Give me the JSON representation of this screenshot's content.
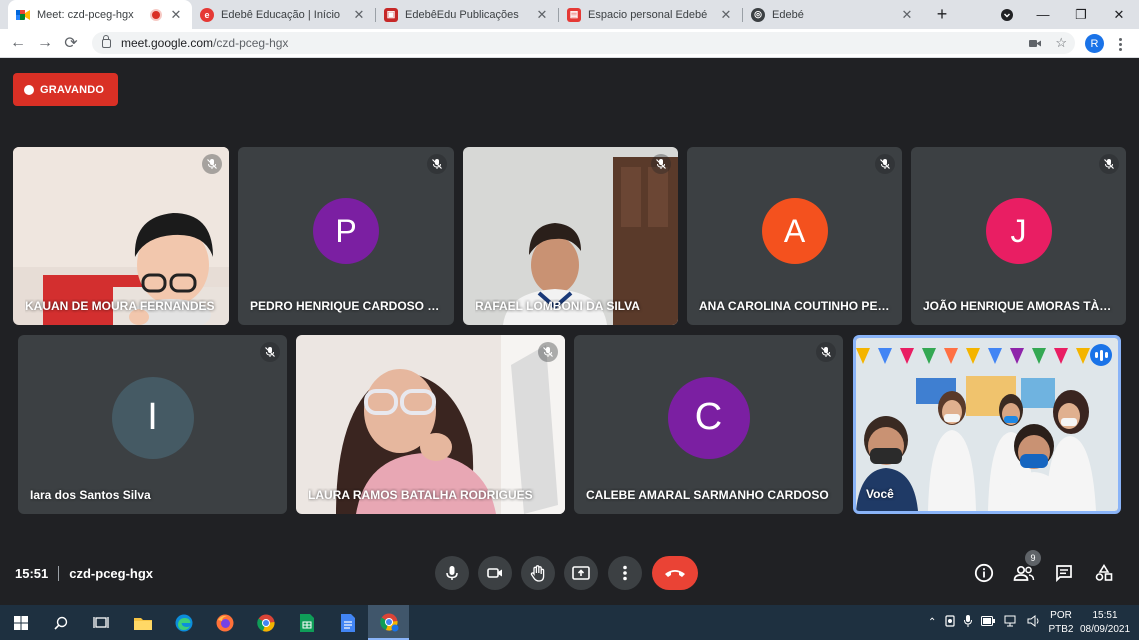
{
  "browser": {
    "tabs": [
      {
        "title": "Meet: czd-pceg-hgx",
        "favicon": "meet-icon",
        "active": true,
        "recording": true
      },
      {
        "title": "Edebê Educação | Início",
        "favicon": "edebe-icon",
        "active": false
      },
      {
        "title": "EdebêEdu Publicações",
        "favicon": "edebe-publicacoes-icon",
        "active": false
      },
      {
        "title": "Espacio personal Edebé",
        "favicon": "edebe-espacio-icon",
        "active": false
      },
      {
        "title": "Edebé",
        "favicon": "edebe-generic-icon",
        "active": false
      }
    ],
    "new_tab_label": "+",
    "address": {
      "host": "meet.google.com",
      "path": "/czd-pceg-hgx"
    },
    "profile_initial": "R"
  },
  "meet": {
    "recording_label": "GRAVANDO",
    "participants": [
      {
        "name": "KAUAN DE MOURA FERNANDES",
        "type": "video",
        "muted": true
      },
      {
        "name": "PEDRO HENRIQUE CARDOSO DE ...",
        "type": "avatar",
        "initial": "P",
        "color": "#7b1fa2",
        "muted": true
      },
      {
        "name": "RAFAEL LOMBONI DA SILVA",
        "type": "video",
        "muted": true
      },
      {
        "name": "ANA CAROLINA COUTINHO PESS...",
        "type": "avatar",
        "initial": "A",
        "color": "#f4511e",
        "muted": true
      },
      {
        "name": "JOÃO HENRIQUE AMORAS TÀVO...",
        "type": "avatar",
        "initial": "J",
        "color": "#e91e63",
        "muted": true
      },
      {
        "name": "Iara dos Santos Silva",
        "type": "avatar",
        "initial": "I",
        "color": "#455a64",
        "muted": true
      },
      {
        "name": "LAURA RAMOS BATALHA RODRIGUES",
        "type": "video",
        "muted": true
      },
      {
        "name": "CALEBE AMARAL SARMANHO CARDOSO",
        "type": "avatar",
        "initial": "C",
        "color": "#7b1fa2",
        "muted": true
      },
      {
        "name": "Você",
        "type": "video",
        "muted": false,
        "speaking": true
      }
    ],
    "time": "15:51",
    "meeting_code": "czd-pceg-hgx",
    "people_count": "9"
  },
  "taskbar": {
    "lang_line1": "POR",
    "lang_line2": "PTB2",
    "time": "15:51",
    "date": "08/09/2021"
  }
}
